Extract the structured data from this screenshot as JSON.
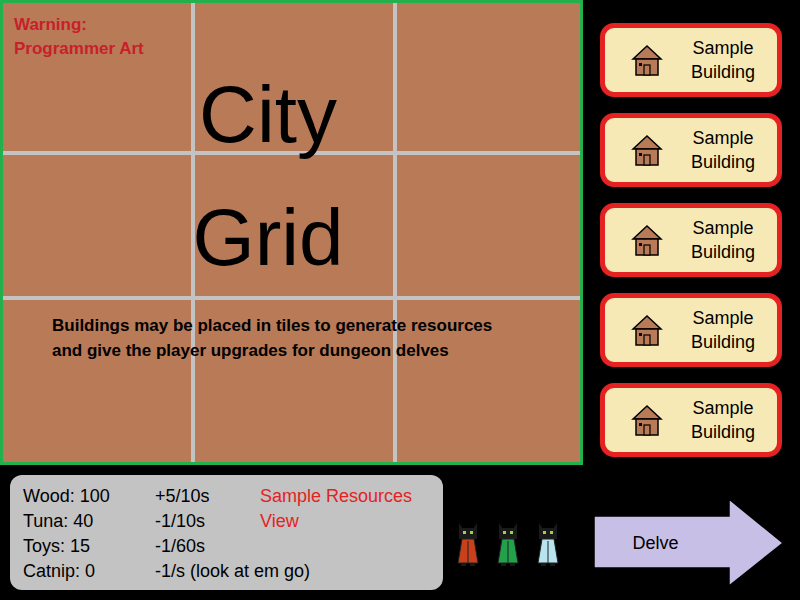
{
  "city_grid": {
    "warning_lines": [
      "Warning:",
      "Programmer Art"
    ],
    "title_lines": [
      "City",
      "Grid"
    ],
    "description_lines": [
      "Buildings may be placed in tiles to generate resources",
      "and give the player upgrades for dungeon delves"
    ]
  },
  "buildings": [
    {
      "label": "Sample Building"
    },
    {
      "label": "Sample Building"
    },
    {
      "label": "Sample Building"
    },
    {
      "label": "Sample Building"
    },
    {
      "label": "Sample Building"
    }
  ],
  "resources": {
    "title": "Sample Resources View",
    "rows": [
      {
        "amount": "Wood: 100",
        "rate": "+5/10s"
      },
      {
        "amount": "Tuna: 40",
        "rate": "-1/10s"
      },
      {
        "amount": "Toys: 15",
        "rate": "-1/60s"
      },
      {
        "amount": "Catnip: 0",
        "rate": "-1/s (look at em go)"
      }
    ]
  },
  "party": [
    {
      "color": "#c8401c"
    },
    {
      "color": "#22a04a"
    },
    {
      "color": "#b8e4f0"
    }
  ],
  "delve": {
    "label": "Delve"
  }
}
